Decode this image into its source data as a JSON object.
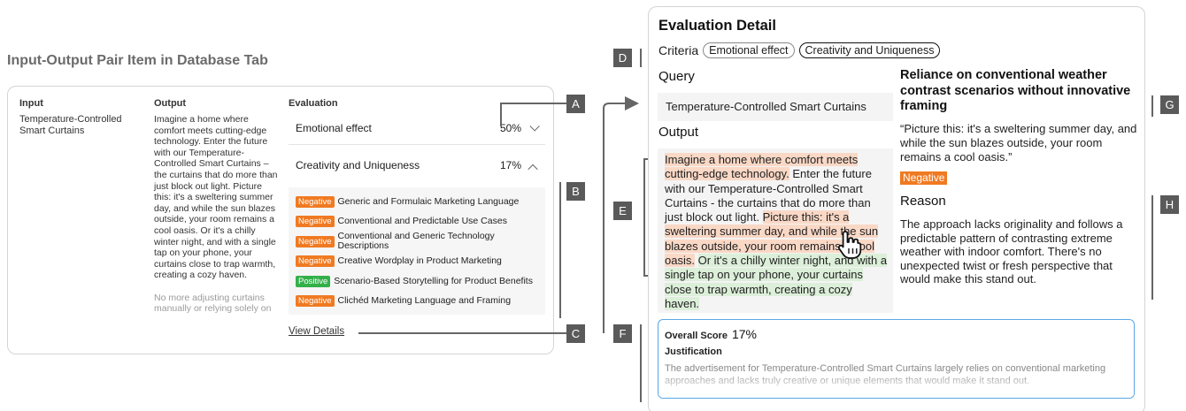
{
  "left": {
    "heading": "Input-Output Pair Item in Database Tab",
    "columns": {
      "input": "Input",
      "output": "Output",
      "evaluation": "Evaluation"
    },
    "input_text": "Temperature-Controlled Smart Curtains",
    "output_para1": "Imagine a home where comfort meets cutting-edge technology. Enter the future with our Temperature-Controlled Smart Curtains – the curtains that do more than just block out light. Picture this: it's a sweltering summer day, and while the sun blazes outside, your room remains a cool oasis. Or it's a chilly winter night, and with a single tap on your phone, your curtains close to trap warmth, creating a cozy haven.",
    "output_para2": "No more adjusting curtains manually or relying solely on",
    "eval": [
      {
        "name": "Emotional effect",
        "score": "50%"
      },
      {
        "name": "Creativity and Uniqueness",
        "score": "17%"
      }
    ],
    "criteria": [
      {
        "tag": "Negative",
        "label": "Generic and Formulaic Marketing Language"
      },
      {
        "tag": "Negative",
        "label": "Conventional and Predictable Use Cases"
      },
      {
        "tag": "Negative",
        "label": "Conventional and Generic Technology Descriptions"
      },
      {
        "tag": "Negative",
        "label": "Creative Wordplay in Product Marketing"
      },
      {
        "tag": "Positive",
        "label": "Scenario-Based Storytelling for Product Benefits"
      },
      {
        "tag": "Negative",
        "label": "Clichéd Marketing Language and Framing"
      }
    ],
    "view_details": "View Details"
  },
  "callouts": {
    "a": "A",
    "b": "B",
    "c": "C",
    "d": "D",
    "e": "E",
    "f": "F",
    "g": "G",
    "h": "H"
  },
  "detail": {
    "title": "Evaluation Detail",
    "criteria_label": "Criteria",
    "pills": [
      "Emotional effect",
      "Creativity and Uniqueness"
    ],
    "query_label": "Query",
    "query_text": "Temperature-Controlled Smart Curtains",
    "output_label": "Output",
    "out_seg1": "Imagine a home where comfort meets cutting-edge technology.",
    "out_seg2": " Enter the future with our Temperature-Controlled Smart Curtains - the curtains that do more than just block out light. ",
    "out_seg3": "Picture this: it's a sweltering summer day, and while the sun blazes outside, your room remains a cool oasis.",
    "out_seg4": " ",
    "out_seg5": "Or it's a chilly winter night, and with a single tap on your phone, your curtains close to trap warmth, creating a cozy haven.",
    "right_heading": "Reliance on conventional weather contrast scenarios without innovative framing",
    "right_quote": "“Picture this: it's a sweltering summer day, and while the sun blazes outside, your room remains a cool oasis.”",
    "right_tag": "Negative",
    "reason_label": "Reason",
    "reason_text": "The approach lacks originality and follows a predictable pattern of contrasting extreme weather with indoor comfort. There's no unexpected twist or fresh perspective that would make this stand out.",
    "overall_label": "Overall Score",
    "overall_value": "17%",
    "justification_label": "Justification",
    "justification_text": "The advertisement for Temperature-Controlled Smart Curtains largely relies on conventional marketing approaches and lacks truly creative or unique elements that would make it stand out."
  },
  "colors": {
    "negative": "#f07a22",
    "positive": "#33b04a",
    "callout": "#5a5a5a",
    "score_border": "#5aa8e6"
  }
}
